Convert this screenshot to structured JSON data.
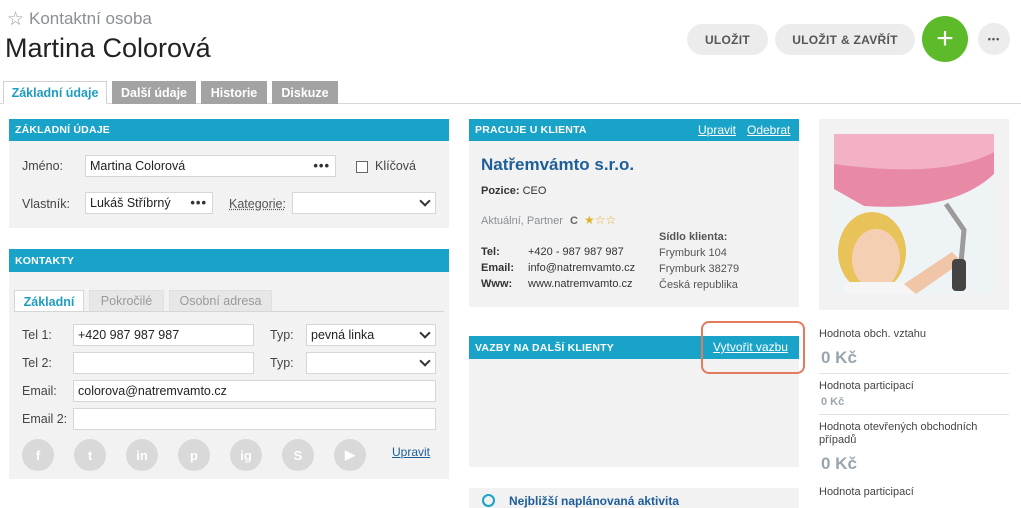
{
  "header": {
    "record_type": "Kontaktní osoba",
    "name": "Martina Colorová",
    "save_label": "ULOŽIT",
    "save_close_label": "ULOŽIT & ZAVŘÍT",
    "add_label": "+",
    "more_label": "•••"
  },
  "tabs": [
    {
      "label": "Základní údaje",
      "active": true
    },
    {
      "label": "Další údaje"
    },
    {
      "label": "Historie"
    },
    {
      "label": "Diskuze"
    }
  ],
  "basic": {
    "title": "ZÁKLADNÍ ÚDAJE",
    "name_label": "Jméno:",
    "name_value": "Martina Colorová",
    "key_label": "Klíčová",
    "owner_label": "Vlastník:",
    "owner_value": "Lukáš Stříbrný",
    "category_label": "Kategorie:",
    "category_value": ""
  },
  "contacts": {
    "title": "KONTAKTY",
    "subtabs": [
      "Základní",
      "Pokročilé",
      "Osobní adresa"
    ],
    "tel1_label": "Tel 1:",
    "tel1_value": "+420 987 987 987",
    "tel2_label": "Tel 2:",
    "tel2_value": "",
    "type_label": "Typ:",
    "type1_value": "pevná linka",
    "type2_value": "",
    "email_label": "Email:",
    "email_value": "colorova@natremvamto.cz",
    "email2_label": "Email 2:",
    "email2_value": "",
    "edit_link": "Upravit",
    "social": [
      "f",
      "t",
      "in",
      "p",
      "ig",
      "S",
      "▶"
    ]
  },
  "client": {
    "title": "PRACUJE U KLIENTA",
    "edit_link": "Upravit",
    "remove_link": "Odebrat",
    "company": "Natřemvámto s.r.o.",
    "position_label": "Pozice:",
    "position_value": "CEO",
    "status": "Aktuální, Partner",
    "rating_letter": "C",
    "stars": "★☆☆",
    "tel_label": "Tel:",
    "tel_value": "+420 - 987 987 987",
    "email_label": "Email:",
    "email_value": "info@natremvamto.cz",
    "www_label": "Www:",
    "www_value": "www.natremvamto.cz",
    "hq_label": "Sídlo klienta:",
    "hq_line1": "Frymburk 104",
    "hq_line2": "Frymburk 38279",
    "hq_line3": "Česká republika"
  },
  "relations": {
    "title": "VAZBY NA DALŠÍ KLIENTY",
    "create_link": "Vytvořit vazbu"
  },
  "next_activity": {
    "label": "Nejbližší naplánovaná aktivita"
  },
  "values": {
    "v1_label": "Hodnota obch. vztahu",
    "v1_value": "0 Kč",
    "v2_label": "Hodnota participací",
    "v2_value": "0 Kč",
    "v3_label": "Hodnota otevřených obchodních případů",
    "v3_value": "0 Kč",
    "v4_label": "Hodnota participací"
  },
  "colors": {
    "accent": "#1aa3c8",
    "add_button": "#5dbb2a",
    "highlight": "#e07b5f"
  }
}
